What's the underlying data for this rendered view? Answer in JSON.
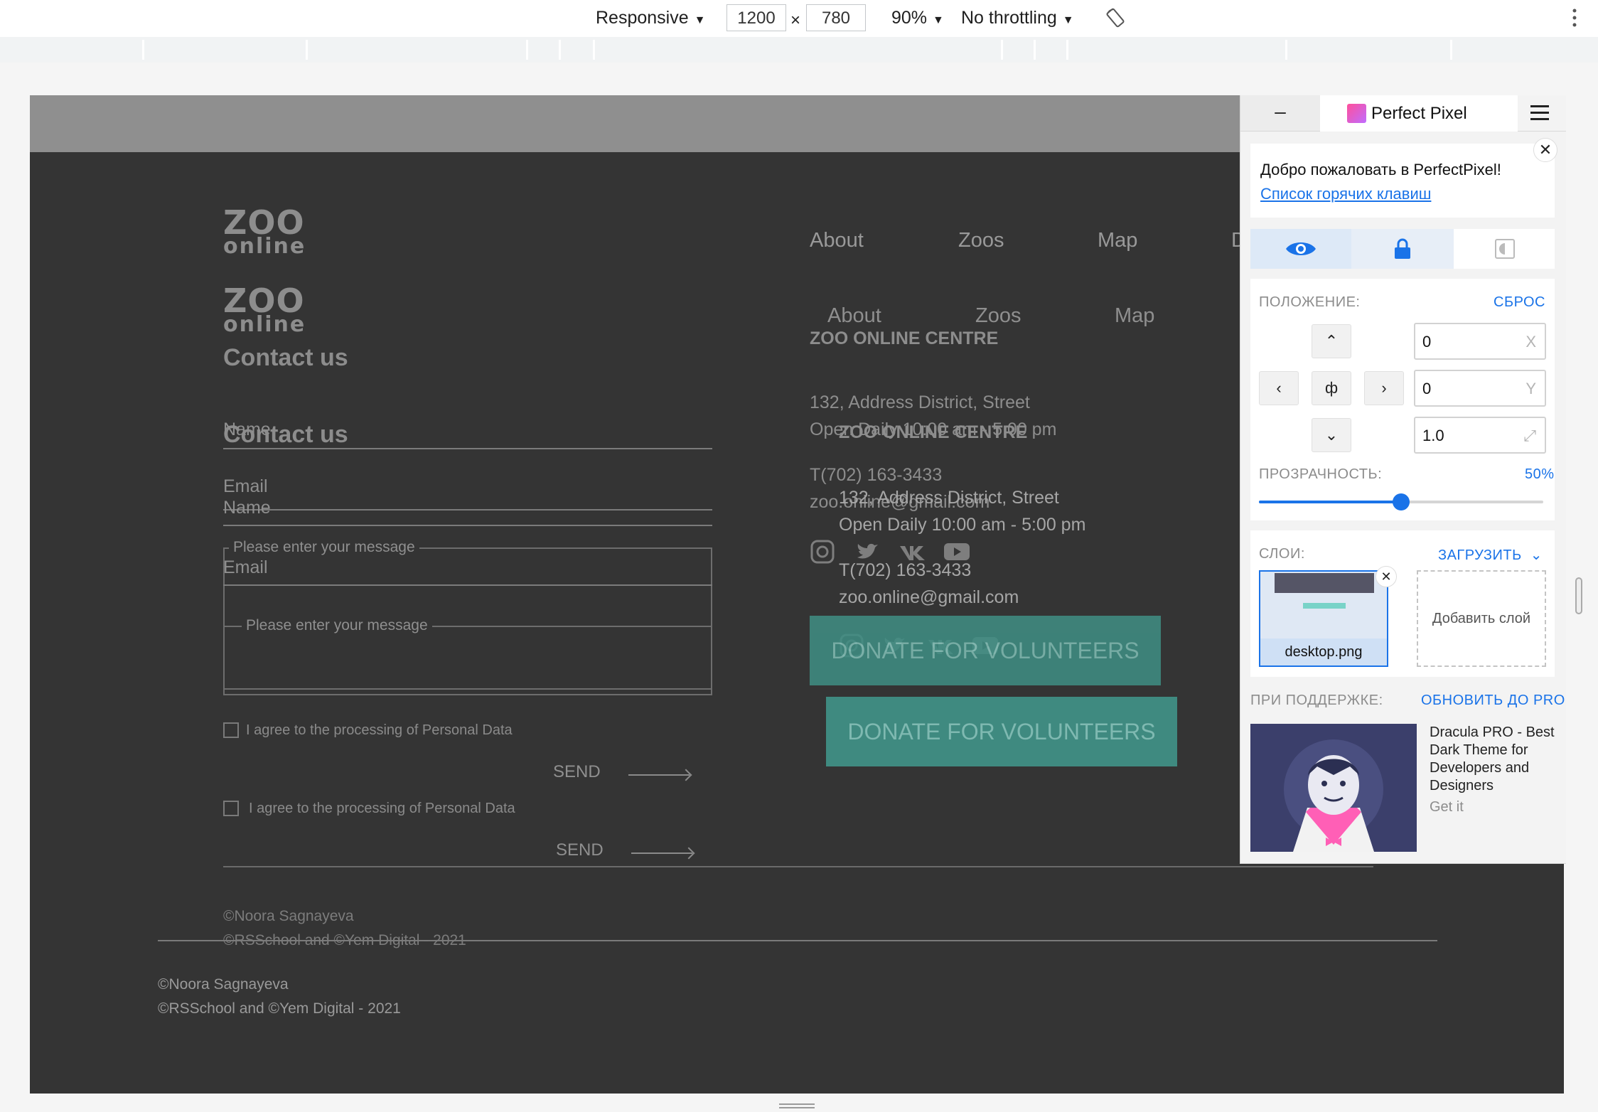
{
  "devtools": {
    "device": "Responsive",
    "width": "1200",
    "height": "780",
    "times": "×",
    "zoom": "90%",
    "throttling": "No throttling"
  },
  "page": {
    "nav": [
      "About",
      "Zoos",
      "Map",
      "D"
    ],
    "nav_ghost": [
      "About",
      "Zoos",
      "Map"
    ],
    "logo_word1": "ZOO",
    "logo_word2": "online",
    "contact_heading": "Contact us",
    "form": {
      "name_label": "Name",
      "email_label": "Email",
      "message_label": "Please enter your message",
      "agree_label": "I agree to the processing of Personal Data",
      "send_label": "SEND"
    },
    "centre": {
      "title": "ZOO ONLINE CENTRE",
      "address": "132, Address District, Street",
      "hours": "Open Daily 10:00 am - 5:00 pm",
      "phone": "T(702) 163-3433",
      "email": "zoo.online@gmail.com"
    },
    "donate_label": "DONATE FOR VOLUNTEERS",
    "copyright_author": "©Noora Sagnayeva",
    "copyright_school": "©RSSchool and ©Yem Digital - 2021"
  },
  "perfectpixel": {
    "minimize": "–",
    "title": "Perfect Pixel",
    "welcome": "Добро пожаловать в PerfectPixel!",
    "hotkeys_link": "Список горячих клавиш",
    "position_label": "ПОЛОЖЕНИЕ:",
    "reset_label": "СБРОС",
    "x_value": "0",
    "x_unit": "X",
    "y_value": "0",
    "y_unit": "Y",
    "scale_value": "1.0",
    "opacity_label": "ПРОЗРАЧНОСТЬ:",
    "opacity_value": "50%",
    "opacity_fraction": 0.5,
    "layers_label": "СЛОИ:",
    "upload_label": "ЗАГРУЗИТЬ",
    "layer_name": "desktop.png",
    "add_layer": "Добавить слой",
    "support_label": "ПРИ ПОДДЕРЖКЕ:",
    "upgrade_label": "ОБНОВИТЬ ДО PRO",
    "promo_title": "Dracula PRO - Best Dark Theme for Developers and Designers",
    "promo_cta": "Get it",
    "accent_color": "#1a73e8"
  }
}
